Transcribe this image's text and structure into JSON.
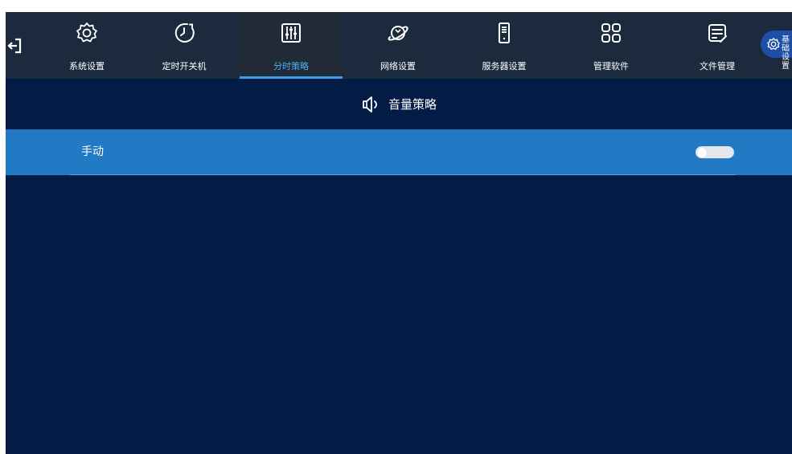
{
  "colors": {
    "screen_bg": "#031c46",
    "topbar_bg": "#1b2a3d",
    "active_tab_bg": "#212b38",
    "active_accent": "#3a9fe8",
    "row_bg": "#2279c4",
    "toggle_off": "#e4e8ee"
  },
  "topbar": {
    "back_icon": "logout-arrow-icon",
    "nav": [
      {
        "label": "系统设置",
        "icon": "gear-icon",
        "active": false
      },
      {
        "label": "定时开关机",
        "icon": "clock-timer-icon",
        "active": false
      },
      {
        "label": "分时策略",
        "icon": "sliders-icon",
        "active": true
      },
      {
        "label": "网络设置",
        "icon": "globe-orbit-icon",
        "active": false
      },
      {
        "label": "服务器设置",
        "icon": "server-tower-icon",
        "active": false
      },
      {
        "label": "管理软件",
        "icon": "app-grid-icon",
        "active": false
      },
      {
        "label": "文件管理",
        "icon": "document-edit-icon",
        "active": false
      }
    ],
    "basic_settings": {
      "label": "基础设置",
      "icon": "gear-icon"
    }
  },
  "section": {
    "title": "音量策略",
    "icon": "speaker-icon"
  },
  "rows": [
    {
      "label": "手动",
      "toggle_on": false
    }
  ]
}
